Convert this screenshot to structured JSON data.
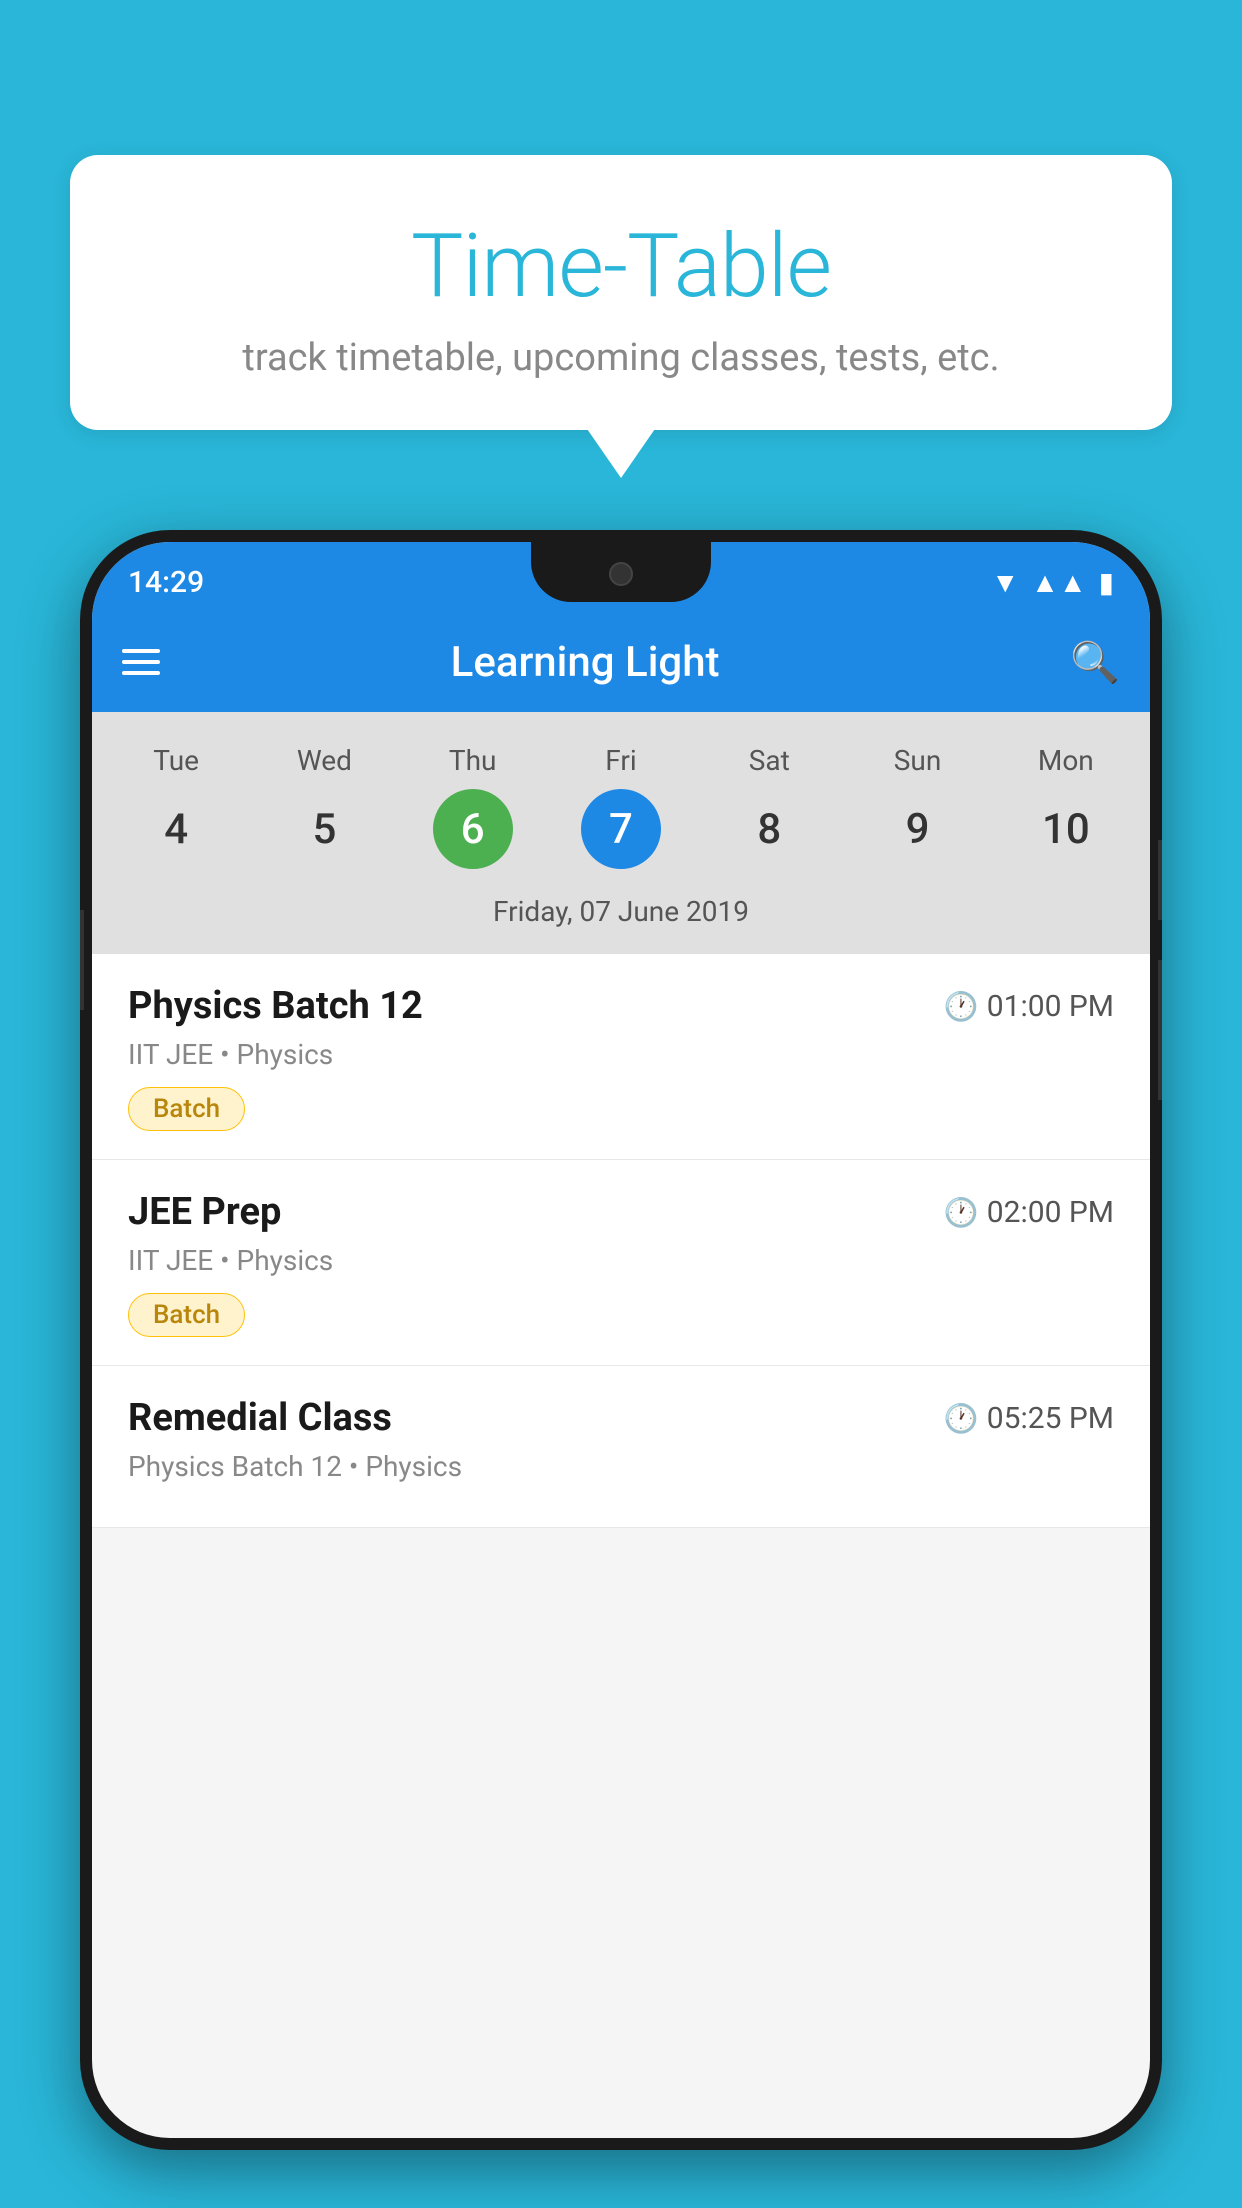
{
  "background_color": "#29b6d8",
  "bubble": {
    "title": "Time-Table",
    "subtitle": "track timetable, upcoming classes, tests, etc."
  },
  "phone": {
    "status_bar": {
      "time": "14:29"
    },
    "app_bar": {
      "title": "Learning Light"
    },
    "calendar": {
      "days": [
        {
          "name": "Tue",
          "num": "4",
          "state": "normal"
        },
        {
          "name": "Wed",
          "num": "5",
          "state": "normal"
        },
        {
          "name": "Thu",
          "num": "6",
          "state": "today"
        },
        {
          "name": "Fri",
          "num": "7",
          "state": "selected"
        },
        {
          "name": "Sat",
          "num": "8",
          "state": "normal"
        },
        {
          "name": "Sun",
          "num": "9",
          "state": "normal"
        },
        {
          "name": "Mon",
          "num": "10",
          "state": "normal"
        }
      ],
      "selected_date_label": "Friday, 07 June 2019"
    },
    "schedule": [
      {
        "title": "Physics Batch 12",
        "time": "01:00 PM",
        "subtitle": "IIT JEE • Physics",
        "tag": "Batch"
      },
      {
        "title": "JEE Prep",
        "time": "02:00 PM",
        "subtitle": "IIT JEE • Physics",
        "tag": "Batch"
      },
      {
        "title": "Remedial Class",
        "time": "05:25 PM",
        "subtitle": "Physics Batch 12 • Physics",
        "tag": ""
      }
    ]
  }
}
